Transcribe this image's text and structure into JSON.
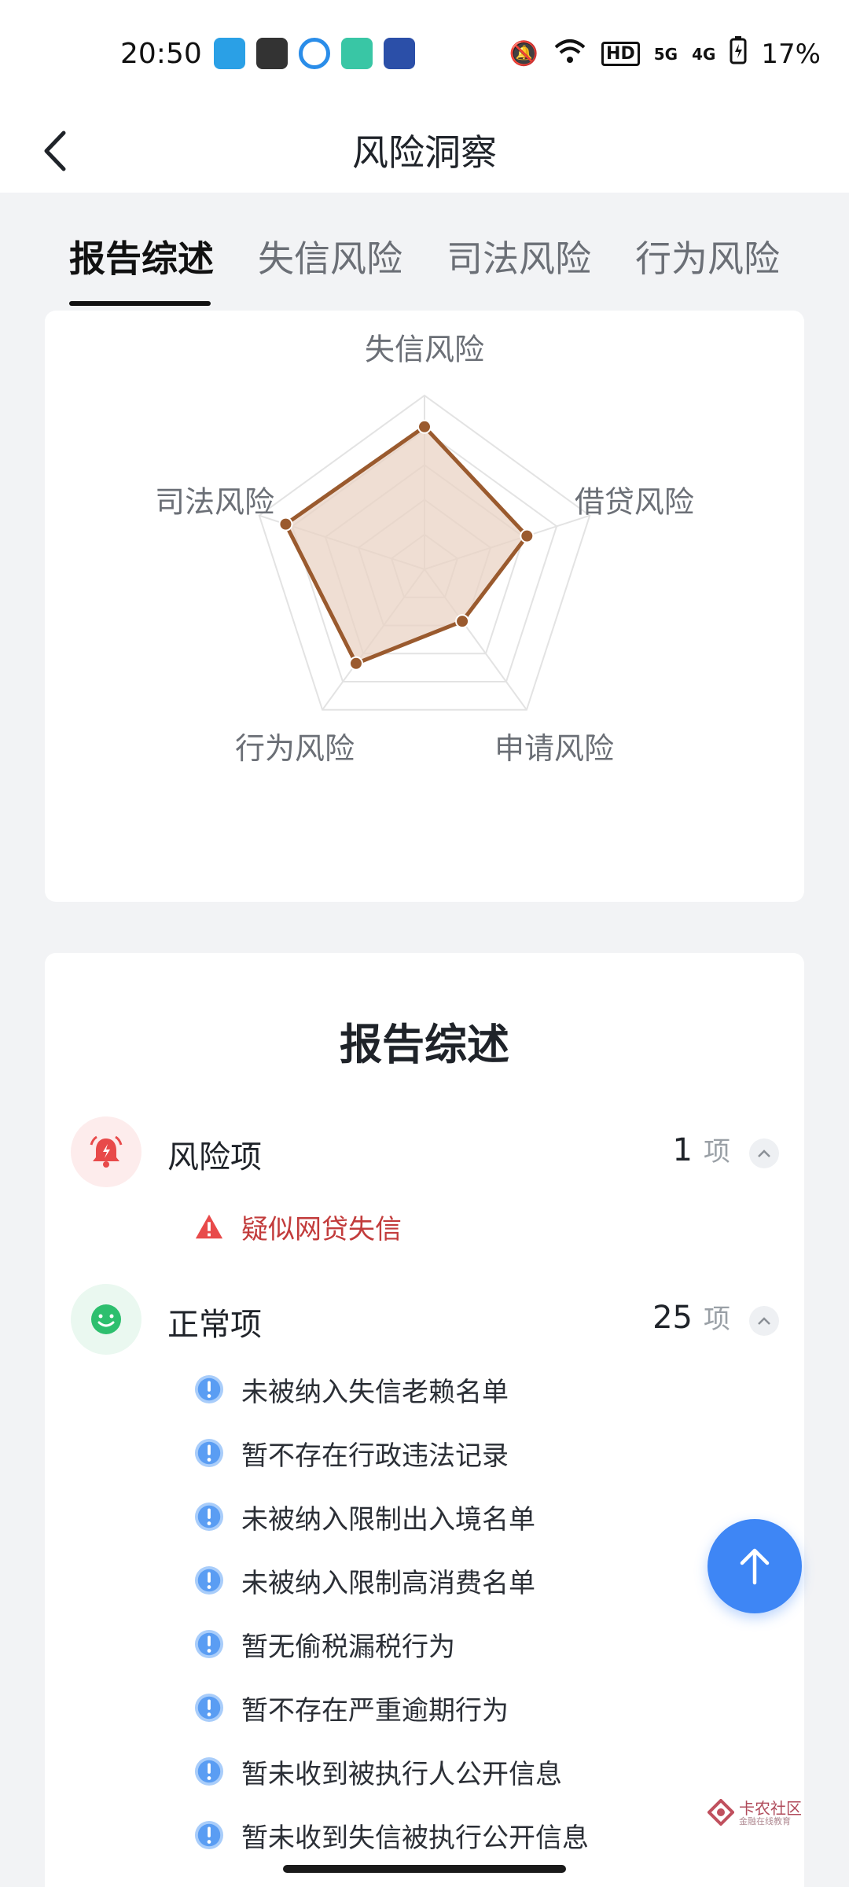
{
  "status_bar": {
    "time": "20:50",
    "network_badge": "HD",
    "signal_1": "5G",
    "signal_2": "4G",
    "battery": "17%"
  },
  "header": {
    "title": "风险洞察"
  },
  "tabs": [
    {
      "label": "报告综述",
      "active": true
    },
    {
      "label": "失信风险",
      "active": false
    },
    {
      "label": "司法风险",
      "active": false
    },
    {
      "label": "行为风险",
      "active": false
    }
  ],
  "radar": {
    "axes": [
      "失信风险",
      "借贷风险",
      "申请风险",
      "行为风险",
      "司法风险"
    ],
    "max": 1.0,
    "rings": 5,
    "values": [
      0.82,
      0.62,
      0.37,
      0.67,
      0.84
    ],
    "colors": {
      "stroke": "#9a5a2e",
      "fill": "#e9d3c4",
      "grid": "#e3e3e3"
    }
  },
  "summary": {
    "title": "报告综述",
    "risk_group": {
      "label": "风险项",
      "count": "1",
      "unit": "项"
    },
    "risk_items": [
      "疑似网贷失信"
    ],
    "normal_group": {
      "label": "正常项",
      "count": "25",
      "unit": "项"
    },
    "normal_items": [
      "未被纳入失信老赖名单",
      "暂不存在行政违法记录",
      "未被纳入限制出入境名单",
      "未被纳入限制高消费名单",
      "暂无偷税漏税行为",
      "暂不存在严重逾期行为",
      "暂未收到被执行人公开信息",
      "暂未收到失信被执行公开信息"
    ]
  },
  "watermark": {
    "text": "卡农社区",
    "sub": "金融在线教育"
  },
  "colors": {
    "accent": "#3e86f5",
    "risk": "#e84a4a",
    "ok": "#2dbf6e"
  }
}
